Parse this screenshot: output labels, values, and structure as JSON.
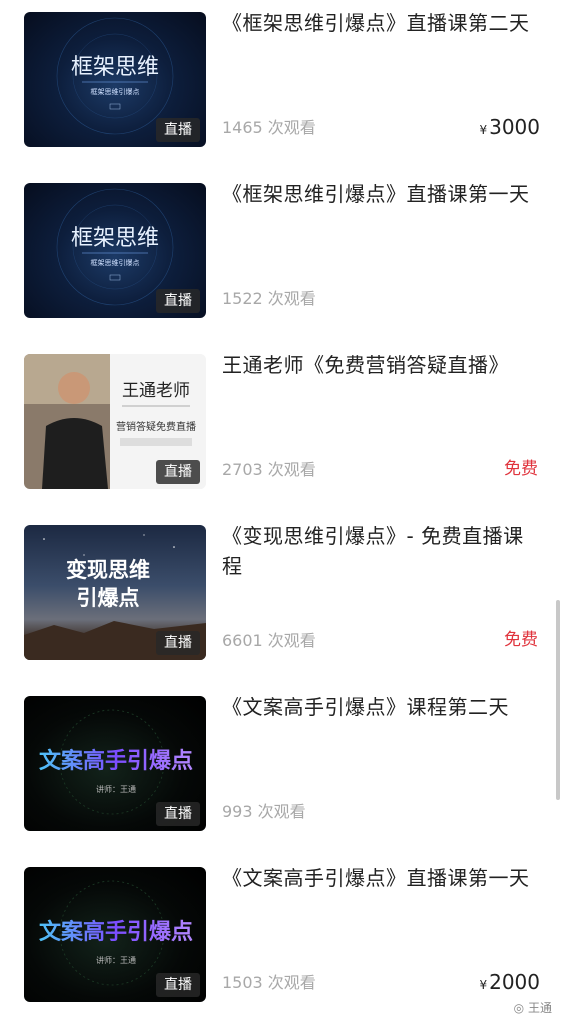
{
  "courses": [
    {
      "title": "《框架思维引爆点》直播课第二天",
      "thumb_title": "框架思维",
      "thumb_subtitle": "框架思维引爆点",
      "badge": "直播",
      "views": "1465 次观看",
      "currency": "¥",
      "price": "3000"
    },
    {
      "title": "《框架思维引爆点》直播课第一天",
      "thumb_title": "框架思维",
      "thumb_subtitle": "框架思维引爆点",
      "badge": "直播",
      "views": "1522 次观看"
    },
    {
      "title": "王通老师《免费营销答疑直播》",
      "thumb_title": "王通老师",
      "thumb_subtitle": "营销答疑免费直播",
      "badge": "直播",
      "views": "2703 次观看",
      "price_label": "免费"
    },
    {
      "title": "《变现思维引爆点》- 免费直播课程",
      "thumb_line1": "变现思维",
      "thumb_line2": "引爆点",
      "badge": "直播",
      "views": "6601 次观看",
      "price_label": "免费"
    },
    {
      "title": "《文案高手引爆点》课程第二天",
      "thumb_title": "文案高手引爆点",
      "thumb_subtitle": "讲师：王通",
      "badge": "直播",
      "views": "993 次观看"
    },
    {
      "title": "《文案高手引爆点》直播课第一天",
      "thumb_title": "文案高手引爆点",
      "thumb_subtitle": "讲师：王通",
      "badge": "直播",
      "views": "1503 次观看",
      "currency": "¥",
      "price": "2000"
    }
  ],
  "watermark": "王通",
  "colors": {
    "free": "#e0343d",
    "views": "#a8a8a8",
    "title": "#222222"
  }
}
